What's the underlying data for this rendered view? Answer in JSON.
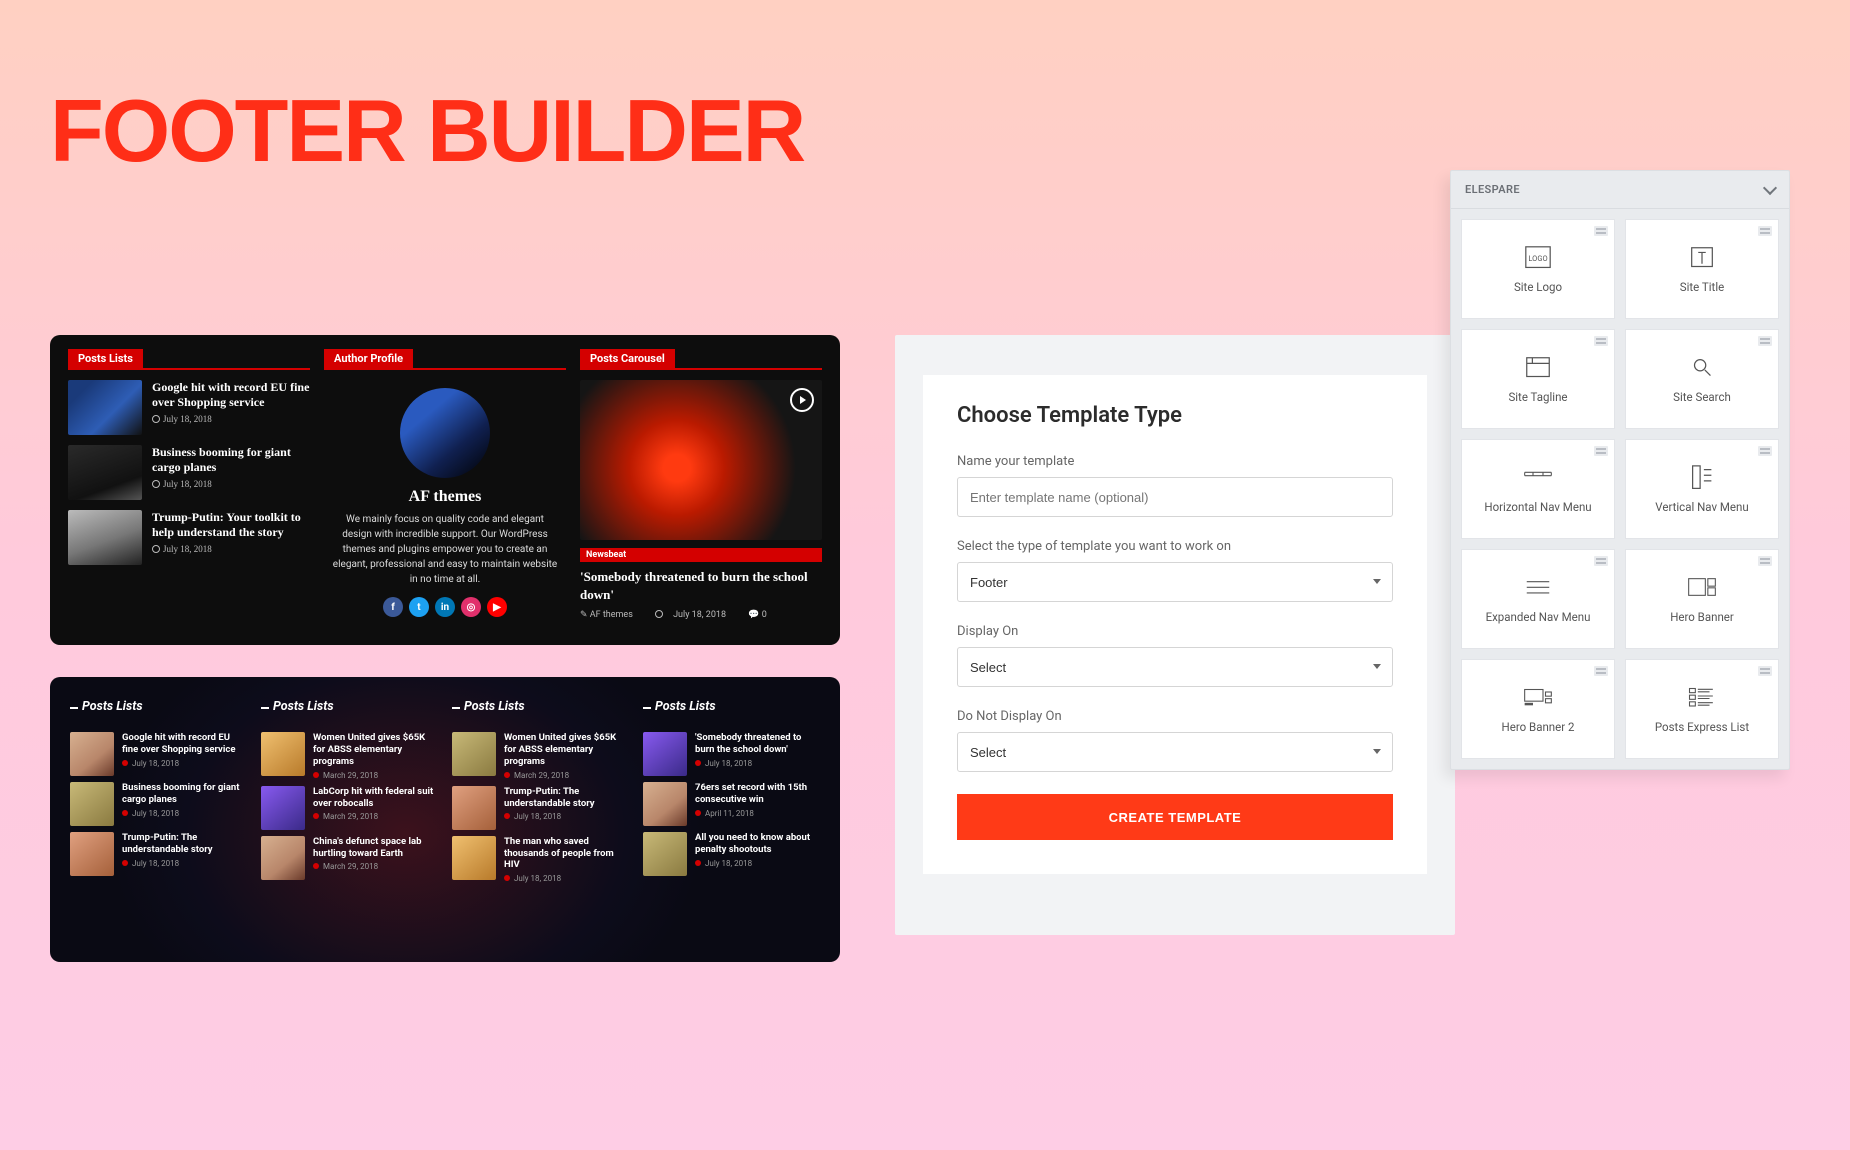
{
  "hero": {
    "title": "FOOTER BUILDER"
  },
  "preview_a": {
    "sections": {
      "posts_lists": "Posts Lists",
      "author_profile": "Author Profile",
      "posts_carousel": "Posts Carousel"
    },
    "posts": [
      {
        "title": "Google hit with record EU fine over Shopping service",
        "date": "July 18, 2018"
      },
      {
        "title": "Business booming for giant cargo planes",
        "date": "July 18, 2018"
      },
      {
        "title": "Trump-Putin: Your toolkit to help understand the story",
        "date": "July 18, 2018"
      }
    ],
    "author": {
      "name": "AF themes",
      "desc": "We mainly focus on quality code and elegant design with incredible support. Our WordPress themes and plugins empower you to create an elegant, professional and easy to maintain website in no time at all."
    },
    "carousel": {
      "badge": "Newsbeat",
      "title": "'Somebody threatened to burn the school down'",
      "author": "AF themes",
      "date": "July 18, 2018",
      "comments": "0"
    }
  },
  "preview_b": {
    "heading": "Posts Lists",
    "cols": [
      [
        {
          "title": "Google hit with record EU fine over Shopping service",
          "date": "July 18, 2018"
        },
        {
          "title": "Business booming for giant cargo planes",
          "date": "July 18, 2018"
        },
        {
          "title": "Trump-Putin: The understandable story",
          "date": "July 18, 2018"
        }
      ],
      [
        {
          "title": "Women United gives $65K for ABSS elementary programs",
          "date": "March 29, 2018"
        },
        {
          "title": "LabCorp hit with federal suit over robocalls",
          "date": "March 29, 2018"
        },
        {
          "title": "China's defunct space lab hurtling toward Earth",
          "date": "March 29, 2018"
        }
      ],
      [
        {
          "title": "Women United gives $65K for ABSS elementary programs",
          "date": "March 29, 2018"
        },
        {
          "title": "Trump-Putin: The understandable story",
          "date": "July 18, 2018"
        },
        {
          "title": "The man who saved thousands of people from HIV",
          "date": "July 18, 2018"
        }
      ],
      [
        {
          "title": "'Somebody threatened to burn the school down'",
          "date": "July 18, 2018"
        },
        {
          "title": "76ers set record with 15th consecutive win",
          "date": "April 11, 2018"
        },
        {
          "title": "All you need to know about penalty shootouts",
          "date": "July 18, 2018"
        }
      ]
    ]
  },
  "form": {
    "heading": "Choose Template Type",
    "name_label": "Name your template",
    "name_placeholder": "Enter template name (optional)",
    "type_label": "Select the type of template you want to work on",
    "type_value": "Footer",
    "display_label": "Display On",
    "display_value": "Select",
    "exclude_label": "Do Not Display On",
    "exclude_value": "Select",
    "create_btn": "CREATE TEMPLATE"
  },
  "widgets": {
    "header": "ELESPARE",
    "items": [
      {
        "label": "Site Logo"
      },
      {
        "label": "Site Title"
      },
      {
        "label": "Site Tagline"
      },
      {
        "label": "Site Search"
      },
      {
        "label": "Horizontal Nav Menu"
      },
      {
        "label": "Vertical Nav Menu"
      },
      {
        "label": "Expanded Nav Menu"
      },
      {
        "label": "Hero Banner"
      },
      {
        "label": "Hero Banner 2"
      },
      {
        "label": "Posts Express List"
      }
    ]
  }
}
